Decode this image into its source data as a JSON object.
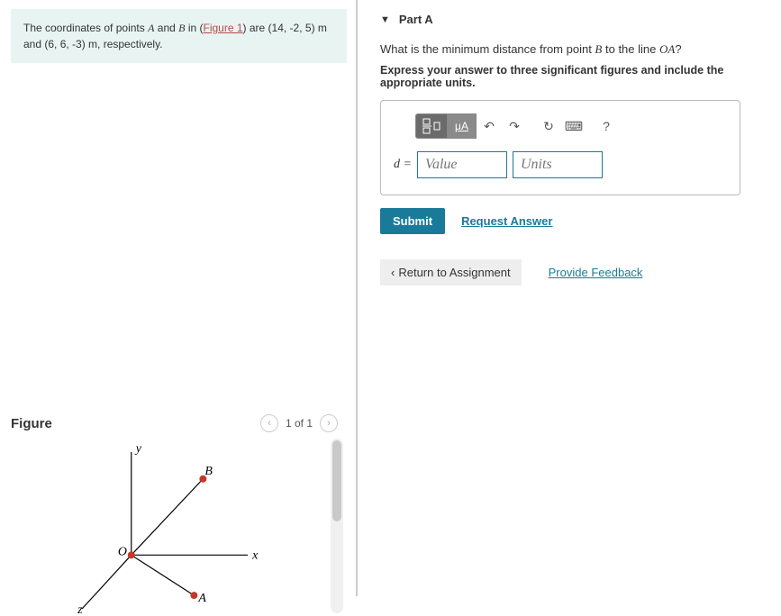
{
  "problem": {
    "pre": "The coordinates of points ",
    "A": "A",
    "mid1": " and ",
    "B": "B",
    "mid2": " in (",
    "figlink": "Figure 1",
    "mid3": ") are (14, -2, 5) ",
    "unit1": "m",
    "mid4": " and (6, 6, -3) ",
    "unit2": "m",
    "post": ", respectively."
  },
  "figure": {
    "title": "Figure",
    "nav": "1 of 1",
    "labels": {
      "y": "y",
      "x": "x",
      "z": "z",
      "O": "O",
      "A": "A",
      "B": "B"
    }
  },
  "part": {
    "label": "Part A",
    "q_pre": "What is the minimum distance from point ",
    "q_B": "B",
    "q_mid": " to the line ",
    "q_OA": "OA",
    "q_post": "?",
    "instr": "Express your answer to three significant figures and include the appropriate units."
  },
  "toolbar": {
    "mu": "μA",
    "undo": "↶",
    "redo": "↷",
    "reset": "↻",
    "keyboard": "⌨",
    "help": "?"
  },
  "answer": {
    "dlabel": "d =",
    "value_ph": "Value",
    "units_ph": "Units"
  },
  "actions": {
    "submit": "Submit",
    "request": "Request Answer",
    "return": "Return to Assignment",
    "feedback": "Provide Feedback"
  }
}
